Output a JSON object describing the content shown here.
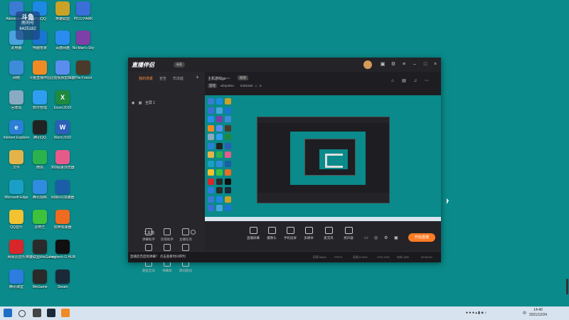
{
  "desktop": {
    "overlay": {
      "line1": "斗鱼",
      "line2": "房间号",
      "line3": "6425182"
    },
    "icons": [
      {
        "label": "Administrator",
        "color": "#3b7bd4",
        "glyph": ""
      },
      {
        "label": "腾讯QQ",
        "color": "#1e88e5",
        "glyph": ""
      },
      {
        "label": "英雄联盟",
        "color": "#c9a227",
        "glyph": ""
      },
      {
        "label": "PICO PARK",
        "color": "#3a6fd8",
        "glyph": ""
      },
      {
        "label": "此电脑",
        "color": "#4aa3df",
        "glyph": ""
      },
      {
        "label": "电脑管家",
        "color": "#1976d2",
        "glyph": ""
      },
      {
        "label": "百度网盘",
        "color": "#2a8cf0",
        "glyph": ""
      },
      {
        "label": "No Man's Sky",
        "color": "#7d3fa8",
        "glyph": ""
      },
      {
        "label": "网络",
        "color": "#3d8bd9",
        "glyph": ""
      },
      {
        "label": "斗鱼直播伴侣",
        "color": "#f08a24",
        "glyph": ""
      },
      {
        "label": "迅雷视频剪辑器",
        "color": "#5b8def",
        "glyph": ""
      },
      {
        "label": "The Forest",
        "color": "#4a3a2a",
        "glyph": ""
      },
      {
        "label": "回收站",
        "color": "#8aa9c2",
        "glyph": ""
      },
      {
        "label": "软件管理",
        "color": "#2f9ef0",
        "glyph": ""
      },
      {
        "label": "Excel 2010",
        "color": "#1f8a3f",
        "glyph": "X"
      },
      {
        "label": "Internet Explorer",
        "color": "#2a7fd6",
        "glyph": "e"
      },
      {
        "label": "腾讯QQ",
        "color": "#222222",
        "glyph": ""
      },
      {
        "label": "Word 2010",
        "color": "#2b5fb8",
        "glyph": "W"
      },
      {
        "label": "文件",
        "color": "#e4b44a",
        "glyph": ""
      },
      {
        "label": "微信",
        "color": "#2bb24c",
        "glyph": ""
      },
      {
        "label": "360极速浏览器",
        "color": "#e65a8a",
        "glyph": ""
      },
      {
        "label": "Microsoft Edge",
        "color": "#1aa0c6",
        "glyph": ""
      },
      {
        "label": "腾讯视频",
        "color": "#2f8ce0",
        "glyph": ""
      },
      {
        "label": "网易UU加速器",
        "color": "#1a5ea8",
        "glyph": ""
      },
      {
        "label": "QQ音乐",
        "color": "#f2c230",
        "glyph": ""
      },
      {
        "label": "爱奇艺",
        "color": "#3ec23c",
        "glyph": ""
      },
      {
        "label": "雷神加速器",
        "color": "#ef6b1f",
        "glyph": ""
      },
      {
        "label": "网易云音乐",
        "color": "#d8262b",
        "glyph": ""
      },
      {
        "label": "英雄联盟WeGame版",
        "color": "#2a2a2a",
        "glyph": ""
      },
      {
        "label": "Logitech G HUB",
        "color": "#101010",
        "glyph": ""
      },
      {
        "label": "腾讯课堂",
        "color": "#2d7ce0",
        "glyph": ""
      },
      {
        "label": "WeGame",
        "color": "#2a2a2a",
        "glyph": ""
      },
      {
        "label": "Steam",
        "color": "#1b2838",
        "glyph": ""
      }
    ]
  },
  "app": {
    "brand": "直播伴侣",
    "brand_badge": "新版",
    "sidebar_tabs": [
      "我的场景",
      "宣告",
      "司法庭"
    ],
    "scene_label": "全屏 1",
    "tools_title": "工具箱",
    "tools": [
      [
        "弹幕助手",
        "房管助手",
        "主播任务"
      ],
      [
        "抽奖抽奖",
        "收入直播",
        "速弹幕"
      ],
      [
        "超级互动",
        "弹幕板",
        "歌词歌词"
      ]
    ],
    "room_title": "主机游戏go~~",
    "room_button": "修改",
    "room_tag": "游戏",
    "room_user": "wfnp3911",
    "room_id": "6425182",
    "room_heat": "0",
    "controls": [
      "直播屏幕",
      "摄像头",
      "手机投屏",
      "多媒体",
      "麦克风",
      "扬声器"
    ],
    "start_button": "开始直播",
    "notice": "直播后百度别弹幕？ 点击查看时间审判",
    "stats": [
      "码率:0kb/s",
      "FPS:0",
      "丢帧:0.00%",
      "CPU:10%",
      "内存:18%",
      "00:00:00"
    ]
  },
  "taskbar": {
    "time": "14:40",
    "date": "2021/12/24",
    "lang": "中"
  }
}
